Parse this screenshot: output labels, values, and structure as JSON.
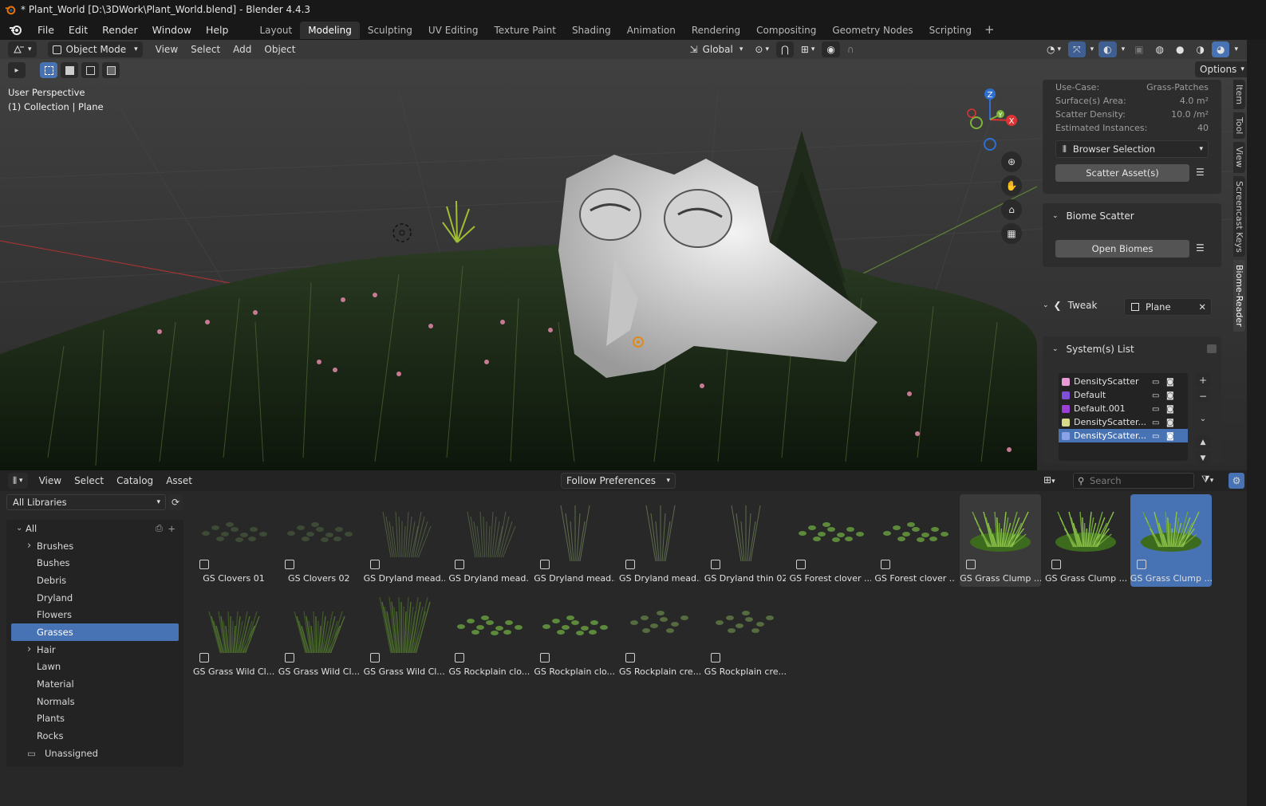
{
  "window": {
    "title": "* Plant_World [D:\\3DWork\\Plant_World.blend] - Blender 4.4.3"
  },
  "menu": [
    "File",
    "Edit",
    "Render",
    "Window",
    "Help"
  ],
  "workspaces": [
    "Layout",
    "Modeling",
    "Sculpting",
    "UV Editing",
    "Texture Paint",
    "Shading",
    "Animation",
    "Rendering",
    "Compositing",
    "Geometry Nodes",
    "Scripting"
  ],
  "active_workspace": "Modeling",
  "viewport": {
    "mode": "Object Mode",
    "menus": [
      "View",
      "Select",
      "Add",
      "Object"
    ],
    "orientation": "Global",
    "options_label": "Options",
    "info_line1": "User Perspective",
    "info_line2": "(1) Collection | Plane",
    "axis_labels": {
      "x": "X",
      "y": "Y",
      "z": "Z"
    }
  },
  "npanel": {
    "props": [
      {
        "label": "Use-Case:",
        "value": "Grass-Patches"
      },
      {
        "label": "Surface(s) Area:",
        "value": "4.0 m²"
      },
      {
        "label": "Scatter Density:",
        "value": "10.0 /m²"
      },
      {
        "label": "Estimated Instances:",
        "value": "40"
      }
    ],
    "browser_selection": "Browser Selection",
    "scatter_btn": "Scatter Asset(s)",
    "biome_title": "Biome Scatter",
    "open_biomes": "Open Biomes",
    "tweak_label": "Tweak",
    "tweak_object": "Plane",
    "systems_title": "System(s) List",
    "systems": [
      {
        "name": "DensityScatter",
        "color": "#e79ad6"
      },
      {
        "name": "Default",
        "color": "#7d4fd6"
      },
      {
        "name": "Default.001",
        "color": "#9b3fd8"
      },
      {
        "name": "DensityScatter....",
        "color": "#d9d98a"
      },
      {
        "name": "DensityScatter....",
        "color": "#8aa2e8",
        "selected": true
      }
    ],
    "side_tabs": [
      "Item",
      "Tool",
      "View",
      "Screencast Keys",
      "Biome-Reader"
    ],
    "active_side_tab": "Biome-Reader"
  },
  "asset_browser": {
    "menus": [
      "View",
      "Select",
      "Catalog",
      "Asset"
    ],
    "import_method": "Follow Preferences",
    "search_placeholder": "Search",
    "library": "All Libraries",
    "catalog_root": "All",
    "catalogs": [
      {
        "name": "Brushes",
        "expand": true
      },
      {
        "name": "Bushes"
      },
      {
        "name": "Debris"
      },
      {
        "name": "Dryland"
      },
      {
        "name": "Flowers"
      },
      {
        "name": "Grasses",
        "selected": true
      },
      {
        "name": "Hair",
        "expand": true
      },
      {
        "name": "Lawn"
      },
      {
        "name": "Material"
      },
      {
        "name": "Normals"
      },
      {
        "name": "Plants"
      },
      {
        "name": "Rocks"
      }
    ],
    "unassigned": "Unassigned",
    "assets": [
      {
        "label": "GS Clovers 01",
        "kind": "clover"
      },
      {
        "label": "GS Clovers 02",
        "kind": "clover"
      },
      {
        "label": "GS Dryland mead...",
        "kind": "dry"
      },
      {
        "label": "GS Dryland mead...",
        "kind": "dry"
      },
      {
        "label": "GS Dryland mead...",
        "kind": "thin"
      },
      {
        "label": "GS Dryland mead...",
        "kind": "thin"
      },
      {
        "label": "GS Dryland thin 02",
        "kind": "thin"
      },
      {
        "label": "GS Forest clover ...",
        "kind": "leafy"
      },
      {
        "label": "GS Forest clover ...",
        "kind": "leafy"
      },
      {
        "label": "GS Grass Clump ...",
        "kind": "clump",
        "state": "hover"
      },
      {
        "label": "GS Grass Clump ...",
        "kind": "clump"
      },
      {
        "label": "GS Grass Clump ...",
        "kind": "clump",
        "state": "selected"
      },
      {
        "label": "GS Grass Wild Cl...",
        "kind": "wild"
      },
      {
        "label": "GS Grass Wild Cl...",
        "kind": "wild"
      },
      {
        "label": "GS Grass Wild Cl...",
        "kind": "wildtall"
      },
      {
        "label": "GS Rockplain clo...",
        "kind": "leafy"
      },
      {
        "label": "GS Rockplain clo...",
        "kind": "leafy"
      },
      {
        "label": "GS Rockplain cre...",
        "kind": "creeper"
      },
      {
        "label": "GS Rockplain cre...",
        "kind": "creeper"
      }
    ]
  },
  "colors": {
    "accent": "#4772b3",
    "bg": "#1d1d1d",
    "panel": "#2d2d2d"
  }
}
